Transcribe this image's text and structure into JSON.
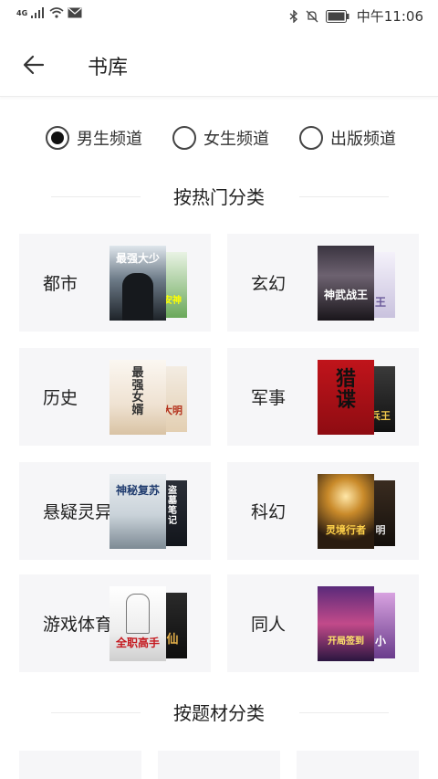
{
  "status_bar": {
    "network": "4G",
    "time": "中午11:06",
    "icons": [
      "signal-icon",
      "wifi-icon",
      "mail-icon",
      "bluetooth-icon",
      "mute-icon",
      "battery-icon"
    ]
  },
  "header": {
    "back_icon": "arrow-left-icon",
    "title": "书库"
  },
  "channels": [
    {
      "label": "男生频道",
      "selected": true
    },
    {
      "label": "女生频道",
      "selected": false
    },
    {
      "label": "出版频道",
      "selected": false
    }
  ],
  "hot_section": {
    "title": "按热门分类",
    "categories": [
      {
        "label": "都市",
        "cover_text": "最强大少",
        "cover_back_text": "安神"
      },
      {
        "label": "玄幻",
        "cover_text": "神武战王",
        "cover_back_text": "王"
      },
      {
        "label": "历史",
        "cover_text": "最强女婿",
        "cover_back_text": "大明"
      },
      {
        "label": "军事",
        "cover_text": "猎谍",
        "cover_back_text": "兵王"
      },
      {
        "label": "悬疑灵异",
        "cover_text": "神秘复苏",
        "cover_back_text": "盗墓笔记"
      },
      {
        "label": "科幻",
        "cover_text": "灵境行者",
        "cover_back_text": "明"
      },
      {
        "label": "游戏体育",
        "cover_text": "全职高手",
        "cover_back_text": "仙"
      },
      {
        "label": "同人",
        "cover_text": "开局签到",
        "cover_back_text": "小"
      }
    ]
  },
  "theme_section": {
    "title": "按题材分类"
  },
  "colors": {
    "card_bg": "#f6f6f8",
    "divider": "#ececec",
    "text": "#222222",
    "radio": "#111111"
  }
}
